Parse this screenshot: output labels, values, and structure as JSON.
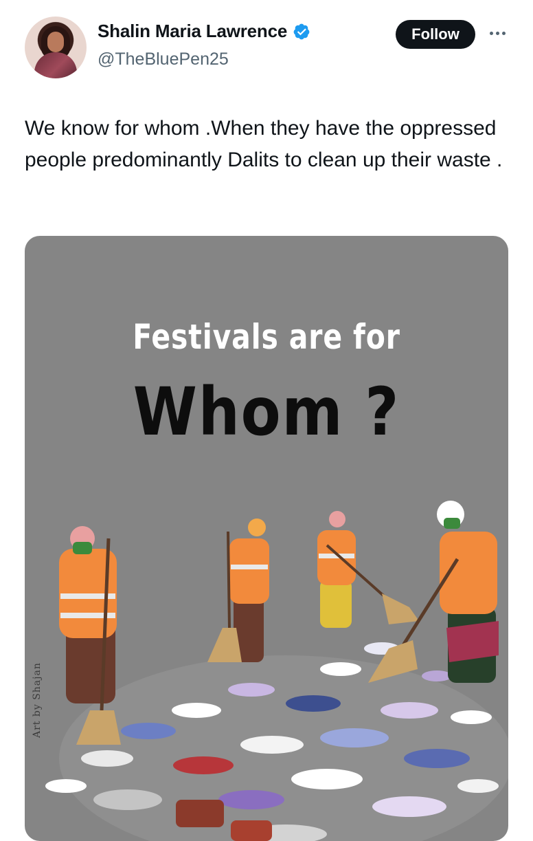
{
  "author": {
    "name": "Shalin Maria Lawrence",
    "handle": "@TheBluePen25",
    "verified_icon": "verified-badge-icon",
    "verified_color": "#1d9bf0"
  },
  "actions": {
    "follow_label": "Follow",
    "more_icon": "more-horizontal-icon"
  },
  "tweet": {
    "text": "We know for whom .When they have the oppressed people predominantly Dalits to clean up their waste ."
  },
  "media": {
    "headline_top": "Festivals are for",
    "headline_bottom": "Whom ?",
    "artist_credit": "Art by Shajan"
  },
  "colors": {
    "background": "#ffffff",
    "text": "#0f1419",
    "secondary_text": "#536471",
    "follow_button": "#0f1419",
    "media_background": "#858585",
    "vest_orange": "#f28a3c"
  }
}
